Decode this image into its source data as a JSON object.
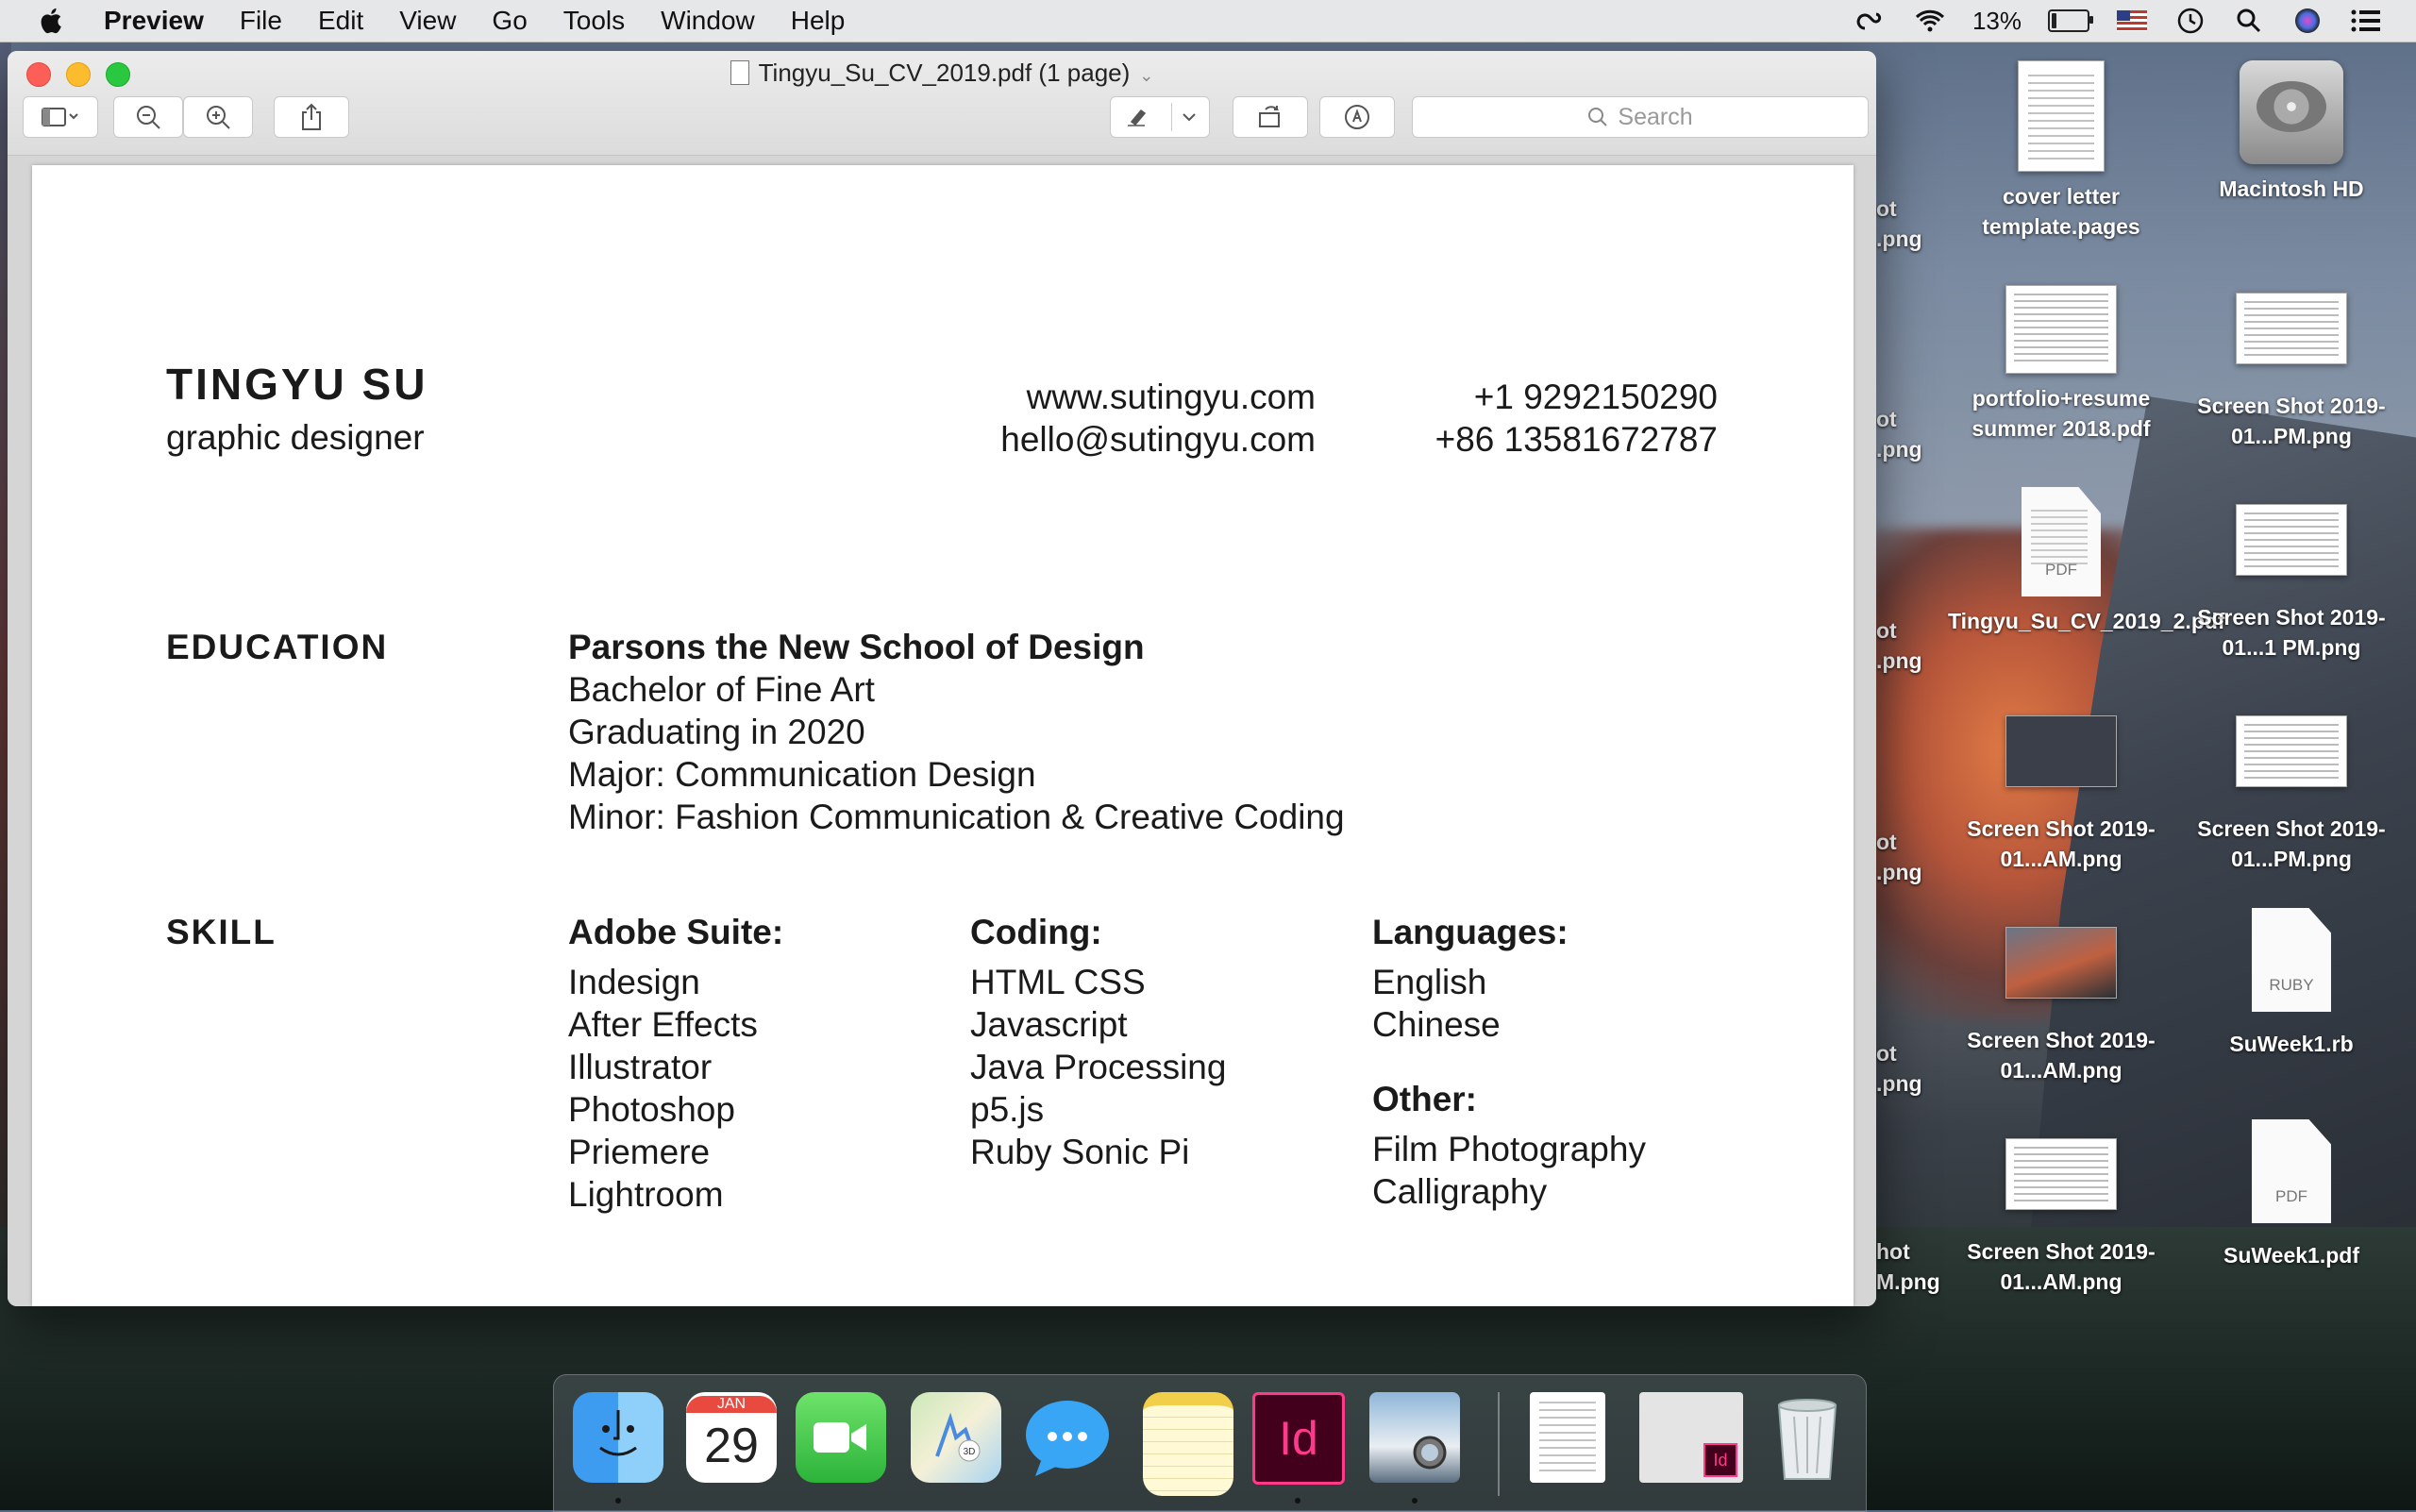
{
  "menubar": {
    "app_name": "Preview",
    "menus": [
      "File",
      "Edit",
      "View",
      "Go",
      "Tools",
      "Window",
      "Help"
    ],
    "battery_percent": "13%",
    "battery_level": 0.13,
    "status_icons": [
      "creative-cloud-icon",
      "wifi-icon",
      "battery-icon",
      "us-flag-icon",
      "time-machine-icon",
      "spotlight-icon",
      "siri-icon",
      "notification-center-icon"
    ]
  },
  "window": {
    "title": "Tingyu_Su_CV_2019.pdf (1 page)",
    "search_placeholder": "Search"
  },
  "cv": {
    "name": "TINGYU SU",
    "role": "graphic designer",
    "website": "www.sutingyu.com",
    "email": "hello@sutingyu.com",
    "phone_us": "+1 9292150290",
    "phone_cn": "+86 13581672787",
    "education": {
      "heading": "EDUCATION",
      "school": "Parsons the New School of Design",
      "lines": [
        "Bachelor of Fine Art",
        "Graduating in 2020",
        "Major: Communication Design",
        "Minor: Fashion Communication & Creative Coding"
      ]
    },
    "skill": {
      "heading": "SKILL",
      "adobe": {
        "title": "Adobe Suite:",
        "items": [
          "Indesign",
          "After Effects",
          "Illustrator",
          "Photoshop",
          "Priemere",
          "Lightroom"
        ]
      },
      "coding": {
        "title": "Coding:",
        "items": [
          "HTML CSS",
          "Javascript",
          "Java Processing",
          "p5.js",
          "Ruby Sonic Pi"
        ]
      },
      "languages": {
        "title": "Languages:",
        "items": [
          "English",
          "Chinese"
        ]
      },
      "other": {
        "title": "Other:",
        "items": [
          "Film Photography",
          "Calligraphy"
        ]
      }
    }
  },
  "desktop": {
    "icons": [
      {
        "label": "cover letter template.pages",
        "type": "document"
      },
      {
        "label": "Macintosh HD",
        "type": "drive"
      },
      {
        "label": "portfolio+resume summer 2018.pdf",
        "type": "document"
      },
      {
        "label": "Screen Shot 2019-01...PM.png",
        "type": "screenshot"
      },
      {
        "label": "Tingyu_Su_CV_2019_2.pdf",
        "type": "pdf"
      },
      {
        "label": "Screen Shot 2019-01...1 PM.png",
        "type": "screenshot"
      },
      {
        "label": "Screen Shot 2019-01...AM.png",
        "type": "screenshot"
      },
      {
        "label": "Screen Shot 2019-01...PM.png",
        "type": "screenshot"
      },
      {
        "label": "Screen Shot 2019-01...AM.png",
        "type": "screenshot"
      },
      {
        "label": "SuWeek1.rb",
        "type": "ruby"
      },
      {
        "label": "Screen Shot 2019-01...AM.png",
        "type": "screenshot"
      },
      {
        "label": "SuWeek1.pdf",
        "type": "pdf"
      }
    ],
    "partial_labels": [
      "ot",
      ".png",
      "ot",
      ".png",
      "ot",
      ".png",
      "ot",
      ".png",
      "ot",
      ".png",
      "hot",
      "M.png"
    ],
    "file_ext_ruby": "RUBY",
    "file_ext_pdf": "PDF"
  },
  "dock": {
    "apps": [
      "Finder",
      "Calendar",
      "FaceTime",
      "Maps",
      "Messages",
      "Notes",
      "InDesign",
      "Preview"
    ],
    "calendar_month": "JAN",
    "calendar_day": "29",
    "indesign_label": "Id",
    "maps_badge": "3D"
  }
}
